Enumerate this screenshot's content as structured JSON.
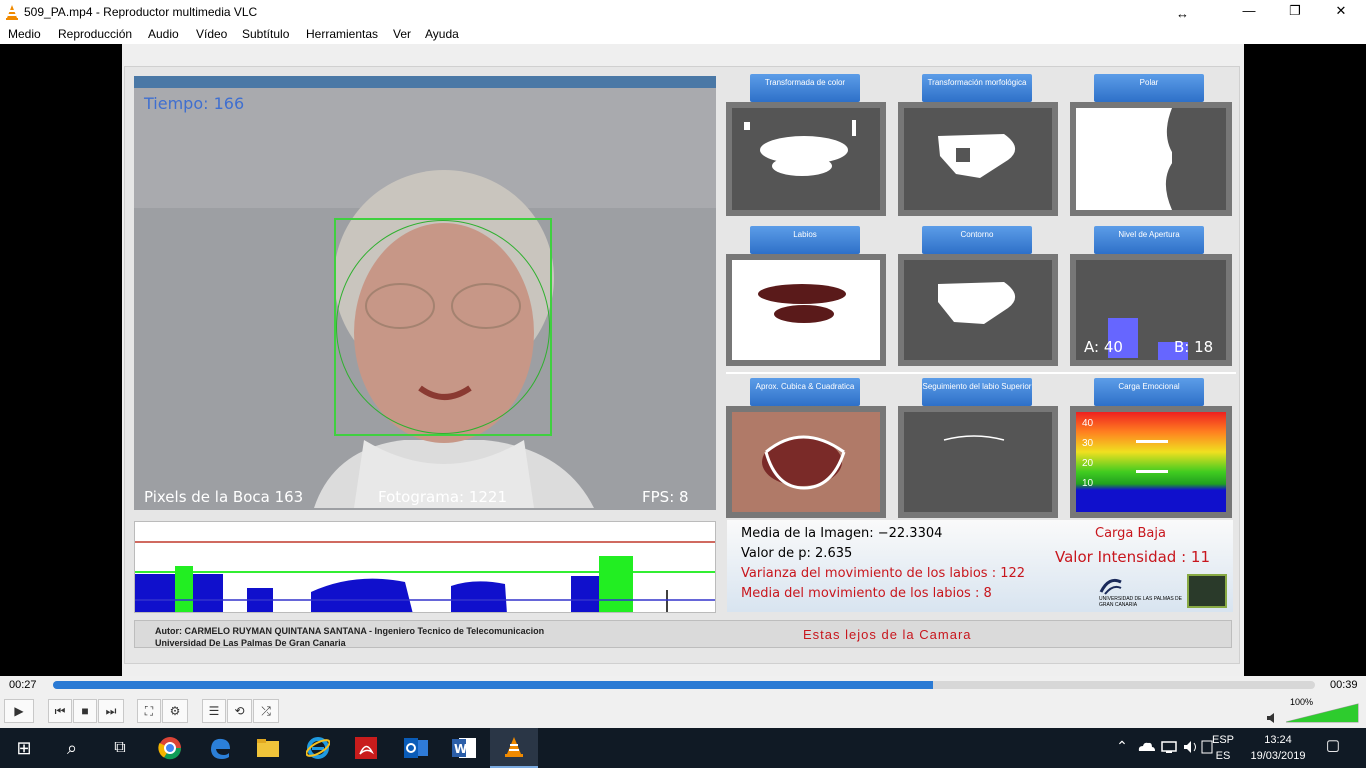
{
  "window": {
    "title": "509_PA.mp4 - Reproductor multimedia VLC",
    "resize_glyph": "↔",
    "minimize": "—",
    "maximize": "❐",
    "close": "✕"
  },
  "menu": [
    "Medio",
    "Reproducción",
    "Audio",
    "Vídeo",
    "Subtítulo",
    "Herramientas",
    "Ver",
    "Ayuda"
  ],
  "video": {
    "tiempo": "Tiempo: 166",
    "pixels": "Pixels de la Boca 163",
    "fotograma": "Fotograma: 1221",
    "fps": "FPS: 8",
    "tiles": {
      "transformada": "Transformada de color",
      "morfologica": "Transformación morfológica",
      "polar": "Polar",
      "labios": "Labios",
      "contorno": "Contorno",
      "apertura": "Nivel de Apertura",
      "aprox": "Aprox. Cubica & Cuadratica",
      "seguimiento": "Seguimiento del labio Superior",
      "carga": "Carga Emocional"
    },
    "apertura_a": "A: 40",
    "apertura_b": "B: 18",
    "carga_ticks": [
      "40",
      "30",
      "20",
      "10"
    ],
    "media_imagen": "Media de la Imagen: −22.3304",
    "valor_p": "Valor de p: 2.635",
    "varianza": "Varianza del movimiento de los labios : 122",
    "media_mov": "Media del movimiento de los labios : 8",
    "carga_baja": "Carga Baja",
    "valor_intensidad": "Valor Intensidad : 11",
    "univ_logo": "UNIVERSIDAD DE LAS PALMAS DE GRAN CANARIA",
    "autor": "Autor: CARMELO RUYMAN QUINTANA SANTANA - Ingeniero Tecnico de Telecomunicacion",
    "universidad": "Universidad De Las Palmas De Gran Canaria",
    "aviso": "Estas lejos de la Camara"
  },
  "player": {
    "elapsed": "00:27",
    "total": "00:39",
    "progress": 0.697,
    "volume": "100%",
    "buttons": {
      "play": "▶",
      "prev": "⏮",
      "stop": "■",
      "next": "⏭",
      "fullscreen": "⛶",
      "extended": "⚙",
      "playlist": "☰",
      "loop": "⟲",
      "shuffle": "⤮"
    }
  },
  "taskbar": {
    "start": "⊞",
    "search": "⌕",
    "taskview": "⧉",
    "lang_top": "ESP",
    "lang_bottom": "ES",
    "time": "13:24",
    "date": "19/03/2019",
    "tray_up": "⌃",
    "notify": "▢"
  }
}
